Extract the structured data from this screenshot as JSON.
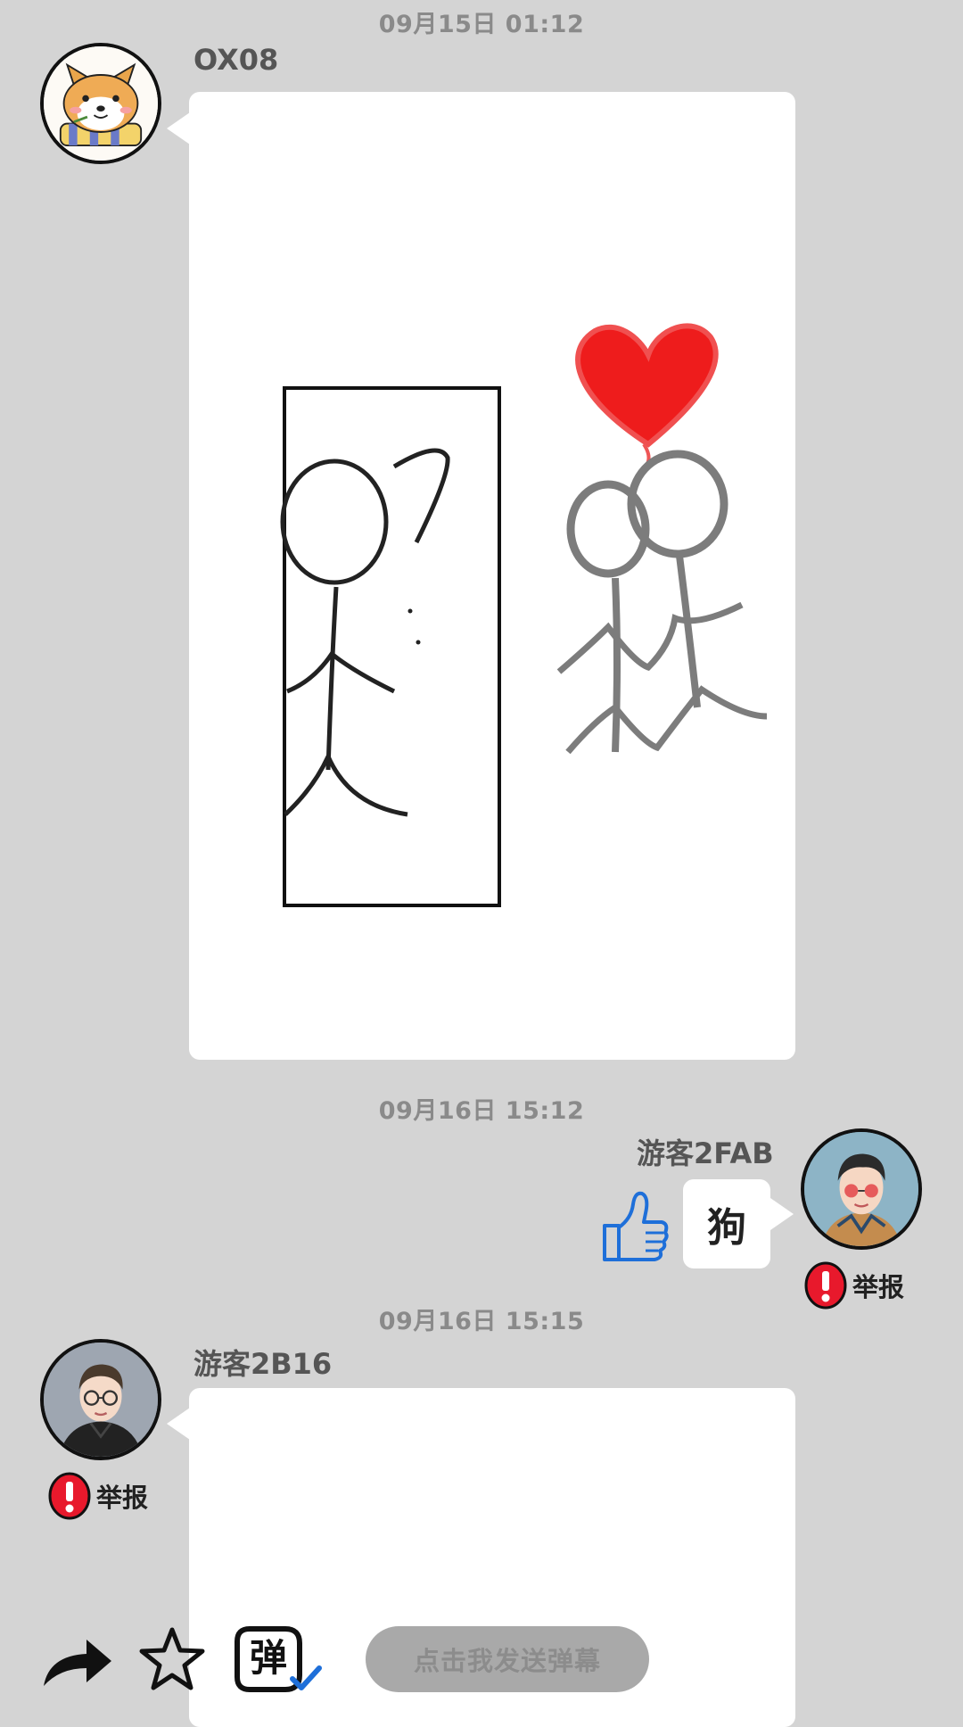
{
  "messages": [
    {
      "timestamp": "09月15日  01:12",
      "username": "OX08",
      "content_type": "drawing",
      "avatar_icon": "shiba-dog-avatar"
    },
    {
      "timestamp": "09月16日  15:12",
      "username": "游客2FAB",
      "text": "狗",
      "avatar_icon": "boy-sunglasses-avatar",
      "report_label": "举报"
    },
    {
      "timestamp": "09月16日  15:15",
      "username": "游客2B16",
      "content_type": "drawing",
      "avatar_icon": "boy-glasses-avatar",
      "report_label": "举报"
    }
  ],
  "bottom_bar": {
    "danmu_placeholder": "点击我发送弹幕",
    "danmu_icon_char": "弹",
    "icons": [
      "share-arrow-icon",
      "star-icon",
      "danmu-toggle-icon"
    ]
  },
  "colors": {
    "background": "#d4d4d4",
    "bubble": "#ffffff",
    "timestamp": "#8a8a8a",
    "heart": "#ee1c1c",
    "like_blue": "#1e6fd9",
    "report_red": "#e8192c"
  }
}
